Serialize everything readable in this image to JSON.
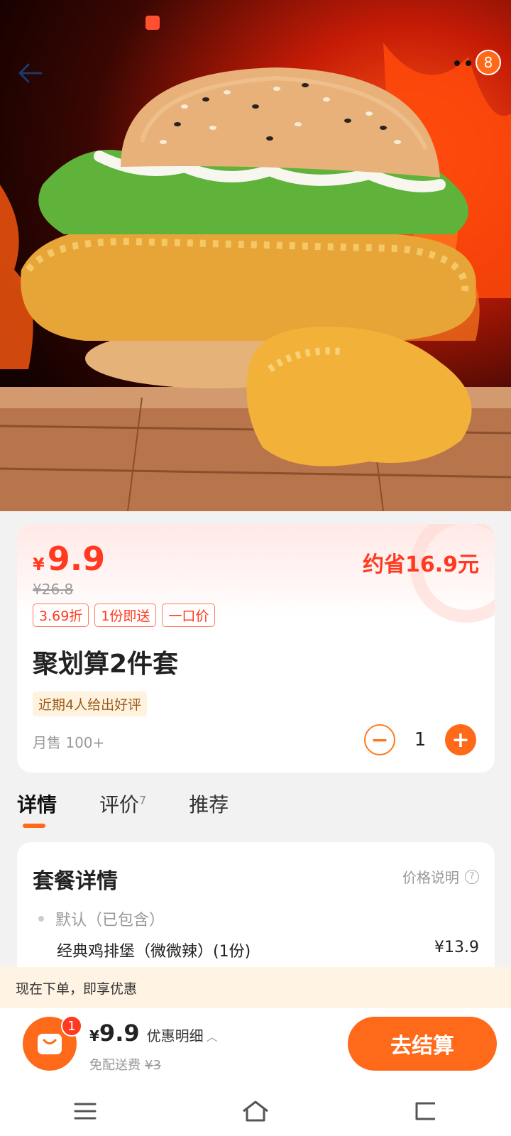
{
  "hero": {
    "more_badge_count": "8",
    "image_icon": "burger-product-photo"
  },
  "product": {
    "currency": "¥",
    "price": "9.9",
    "original_price": "¥26.8",
    "save_text": "约省16.9元",
    "tags": [
      "3.69折",
      "1份即送",
      "一口价"
    ],
    "title": "聚划算2件套",
    "review_tag": "近期4人给出好评",
    "sales": "月售 100+",
    "quantity": "1",
    "minus_label": "−",
    "plus_label": "+"
  },
  "tabs": {
    "detail": "详情",
    "reviews": "评价",
    "reviews_count": "7",
    "recommend": "推荐"
  },
  "detail": {
    "title": "套餐详情",
    "price_note": "价格说明",
    "default_label": "默认（已包含）",
    "item_name": "经典鸡排堡（微微辣）(1份)",
    "item_price": "¥13.9"
  },
  "promo": {
    "text": "现在下单，即享优惠"
  },
  "bottom": {
    "cart_badge": "1",
    "currency": "¥",
    "total": "9.9",
    "discount_link": "优惠明细",
    "delivery_label": "免配送费",
    "delivery_original": "¥3",
    "checkout": "去结算"
  },
  "colors": {
    "accent": "#ff6a1a",
    "price_red": "#ff3a20"
  }
}
